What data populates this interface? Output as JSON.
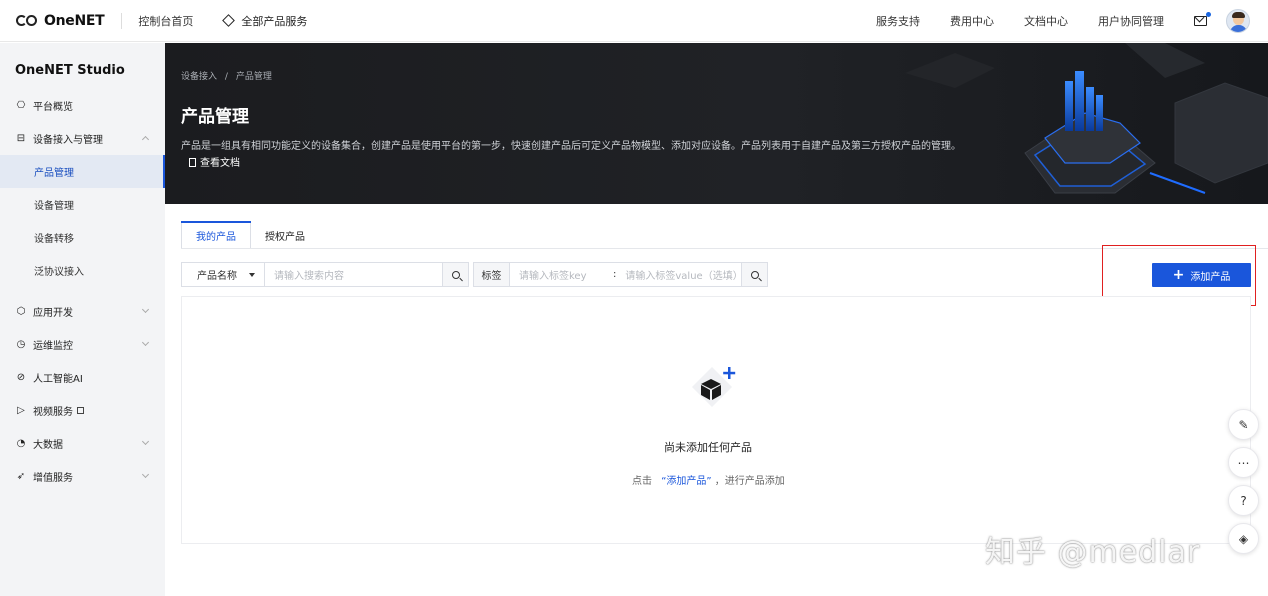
{
  "topbar": {
    "logo": "OneNET",
    "console_home": "控制台首页",
    "all_products": "全部产品服务",
    "nav": [
      "服务支持",
      "费用中心",
      "文档中心",
      "用户协同管理"
    ],
    "icons": [
      "mail-icon",
      "avatar"
    ]
  },
  "sidebar": {
    "title": "OneNET Studio",
    "items": [
      {
        "label": "平台概览",
        "icon": "overview-icon"
      },
      {
        "label": "设备接入与管理",
        "icon": "device-icon",
        "expanded": true
      },
      {
        "label": "应用开发",
        "icon": "app-icon"
      },
      {
        "label": "运维监控",
        "icon": "monitor-icon"
      },
      {
        "label": "人工智能AI",
        "icon": "ai-icon"
      },
      {
        "label": "视频服务",
        "icon": "video-icon"
      },
      {
        "label": "大数据",
        "icon": "bigdata-icon"
      },
      {
        "label": "增值服务",
        "icon": "value-added-icon"
      }
    ],
    "subitems": [
      "产品管理",
      "设备管理",
      "设备转移",
      "泛协议接入"
    ],
    "active_subitem": "产品管理"
  },
  "banner": {
    "breadcrumb": [
      "设备接入",
      "/",
      "产品管理"
    ],
    "title": "产品管理",
    "description": "产品是一组具有相同功能定义的设备集合，创建产品是使用平台的第一步，快速创建产品后可定义产品物模型、添加对应设备。产品列表用于自建产品及第三方授权产品的管理。",
    "doc_link": "查看文档"
  },
  "tabs": [
    "我的产品",
    "授权产品"
  ],
  "active_tab": "我的产品",
  "search": {
    "select_value": "产品名称",
    "placeholder": "请输入搜索内容",
    "tag_label": "标签",
    "tag_key_placeholder": "请输入标签key",
    "colon": ":",
    "tag_value_placeholder": "请输入标签value（选填）"
  },
  "add_button": "添加产品",
  "empty": {
    "title": "尚未添加任何产品",
    "hint_prefix": "点击",
    "hint_link": "“添加产品”",
    "hint_suffix": "，进行产品添加"
  },
  "floating_tools": [
    "edit-icon",
    "chat-icon",
    "help-icon",
    "service-icon"
  ],
  "watermark": "知乎 @medlar",
  "colors": {
    "primary": "#1a56db",
    "banner_bg": "#1b1c1f",
    "sidebar_bg": "#f3f4f6",
    "highlight": "#e02020"
  }
}
